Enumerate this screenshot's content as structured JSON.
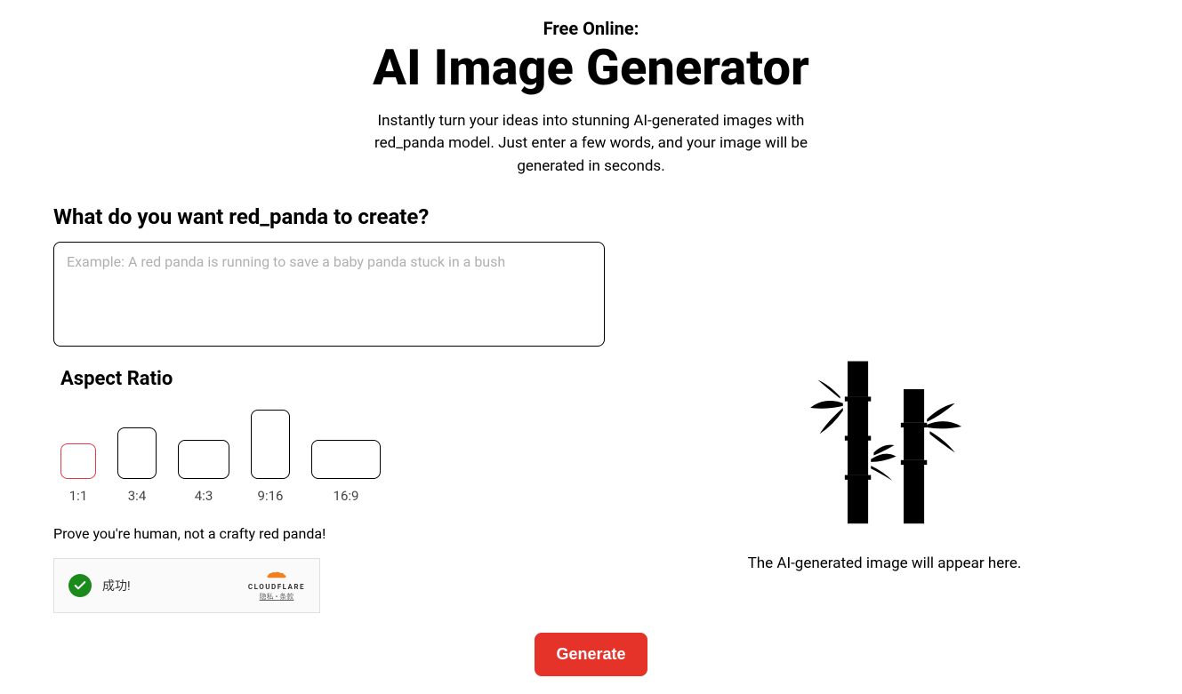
{
  "header": {
    "subtitle": "Free Online:",
    "title": "AI Image Generator",
    "description": "Instantly turn your ideas into stunning AI-generated images with red_panda model. Just enter a few words, and your image will be generated in seconds."
  },
  "prompt": {
    "label": "What do you want red_panda to create?",
    "placeholder": "Example: A red panda is running to save a baby panda stuck in a bush",
    "value": ""
  },
  "aspect": {
    "label": "Aspect Ratio",
    "options": [
      {
        "label": "1:1",
        "selected": true
      },
      {
        "label": "3:4",
        "selected": false
      },
      {
        "label": "4:3",
        "selected": false
      },
      {
        "label": "9:16",
        "selected": false
      },
      {
        "label": "16:9",
        "selected": false
      }
    ]
  },
  "captcha": {
    "label": "Prove you're human, not a crafty red panda!",
    "status": "成功!",
    "brand": "CLOUDFLARE",
    "links": "隐私 • 条款"
  },
  "generate_button": "Generate",
  "preview": {
    "placeholder_text": "The AI-generated image will appear here."
  }
}
